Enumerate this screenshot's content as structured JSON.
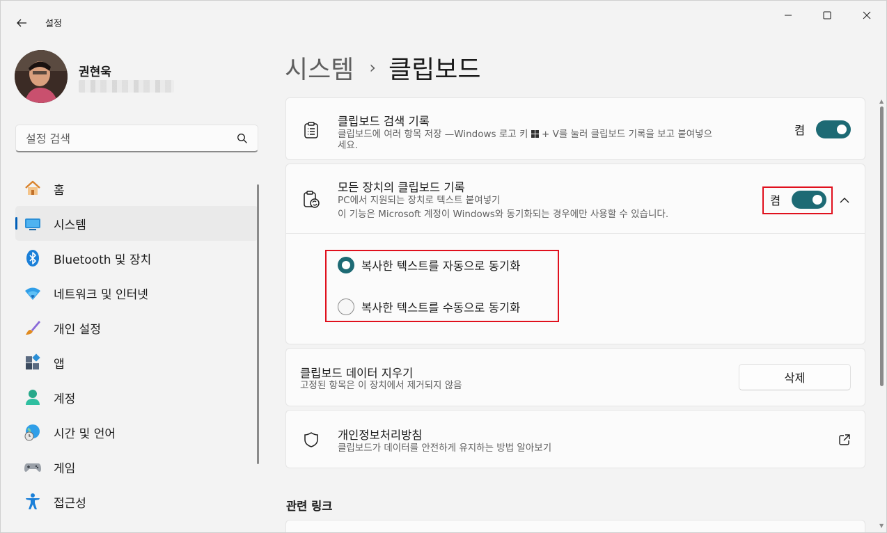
{
  "window": {
    "title": "설정"
  },
  "profile": {
    "name": "권현욱"
  },
  "search": {
    "placeholder": "설정 검색"
  },
  "nav": {
    "items": [
      {
        "label": "홈",
        "icon": "home-icon"
      },
      {
        "label": "시스템",
        "icon": "system-icon",
        "active": true
      },
      {
        "label": "Bluetooth 및 장치",
        "icon": "bluetooth-icon"
      },
      {
        "label": "네트워크 및 인터넷",
        "icon": "wifi-icon"
      },
      {
        "label": "개인 설정",
        "icon": "paintbrush-icon"
      },
      {
        "label": "앱",
        "icon": "apps-icon"
      },
      {
        "label": "계정",
        "icon": "account-icon"
      },
      {
        "label": "시간 및 언어",
        "icon": "globe-clock-icon"
      },
      {
        "label": "게임",
        "icon": "gamepad-icon"
      },
      {
        "label": "접근성",
        "icon": "accessibility-icon"
      }
    ]
  },
  "breadcrumb": {
    "parent": "시스템",
    "separator": "›",
    "current": "클립보드"
  },
  "cards": {
    "history": {
      "title": "클립보드 검색 기록",
      "desc_line1": "클립보드에 여러 항목 저장 —Windows 로고 키 ",
      "desc_line1b": " + V를 눌러 클립보드 기록을 보고 붙여넣으",
      "desc_line2": "세요.",
      "toggle_label": "켬",
      "toggle_on": true
    },
    "sync": {
      "title": "모든 장치의 클립보드 기록",
      "desc_line1": "PC에서 지원되는 장치로 텍스트 붙여넣기",
      "desc_line2": "이 기능은 Microsoft 계정이 Windows와 동기화되는 경우에만 사용할 수 있습니다.",
      "toggle_label": "켬",
      "toggle_on": true,
      "options": [
        {
          "label": "복사한 텍스트를 자동으로 동기화",
          "selected": true
        },
        {
          "label": "복사한 텍스트를 수동으로 동기화",
          "selected": false
        }
      ]
    },
    "clear": {
      "title": "클립보드 데이터 지우기",
      "desc": "고정된 항목은 이 장치에서 제거되지 않음",
      "button_label": "삭제"
    },
    "privacy": {
      "title": "개인정보처리방침",
      "desc": "클립보드가 데이터를 안전하게 유지하는 방법 알아보기"
    }
  },
  "related": {
    "title": "관련 링크"
  },
  "colors": {
    "accent": "#1d6a74",
    "highlight": "#e0101d",
    "nav_indicator": "#005fb8"
  }
}
